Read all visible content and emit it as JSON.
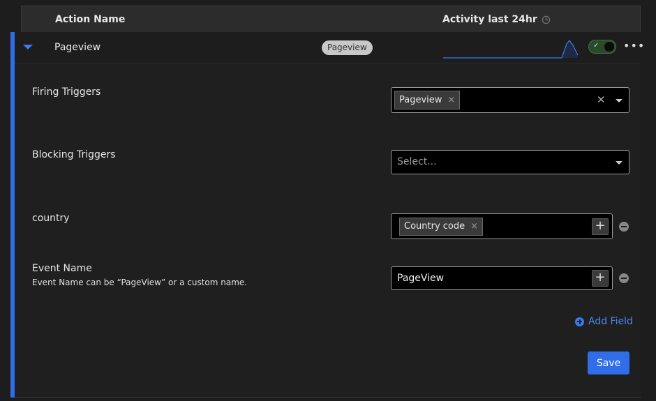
{
  "table": {
    "col_action_name": "Action Name",
    "col_activity": "Activity last 24hr"
  },
  "row": {
    "name": "Pageview",
    "badge": "Pageview",
    "enabled": true
  },
  "fields": {
    "firing_triggers": {
      "label": "Firing Triggers",
      "chips": [
        "Pageview"
      ]
    },
    "blocking_triggers": {
      "label": "Blocking Triggers",
      "placeholder": "Select..."
    },
    "country": {
      "label": "country",
      "chips": [
        "Country code"
      ]
    },
    "event_name": {
      "label": "Event Name",
      "help": "Event Name can be “PageView” or a custom name.",
      "value": "PageView"
    }
  },
  "add_field_label": "Add Field",
  "save_label": "Save",
  "colors": {
    "accent": "#2f6ee8",
    "background": "#1f1f1f",
    "toggle_on": "#2a4a2a"
  }
}
